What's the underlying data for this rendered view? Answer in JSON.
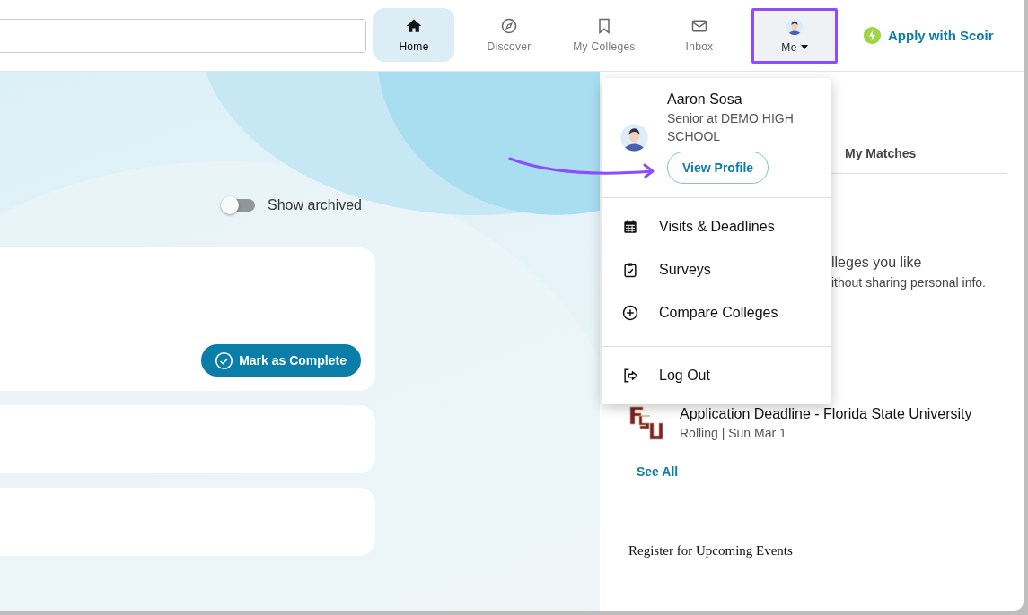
{
  "nav": [
    {
      "label": "Home",
      "selected": true,
      "expanded": false,
      "highlighted": false
    },
    {
      "label": "Discover",
      "selected": false,
      "expanded": false,
      "highlighted": false
    },
    {
      "label": "My Colleges",
      "selected": false,
      "expanded": false,
      "highlighted": false
    },
    {
      "label": "Inbox",
      "selected": false,
      "expanded": false,
      "highlighted": false
    },
    {
      "label": "Me",
      "selected": false,
      "expanded": true,
      "highlighted": true
    }
  ],
  "apply_button": {
    "label": "Apply with Scoir"
  },
  "show_archived": {
    "label": "Show archived",
    "checked": false
  },
  "task_card": {
    "button": "Mark as Complete"
  },
  "right_panel": {
    "tabs": [
      {
        "label": "My Matches",
        "selected": false
      }
    ],
    "intro_line_1": "lleges you like",
    "intro_line_2": "ithout sharing personal info.",
    "deadlines": [
      {
        "title": "Application Deadline - Florida State University",
        "subtitle": "Rolling | Sun Mar 1"
      }
    ],
    "see_all": "See All",
    "events_heading": "Register for Upcoming Events"
  },
  "menu": {
    "name": "Aaron Sosa",
    "subtitle": "Senior at DEMO HIGH SCHOOL",
    "profile_button": "View Profile",
    "items": [
      {
        "label": "Visits & Deadlines"
      },
      {
        "label": "Surveys"
      },
      {
        "label": "Compare Colleges"
      }
    ],
    "footer_items": [
      {
        "label": "Log Out"
      }
    ]
  }
}
